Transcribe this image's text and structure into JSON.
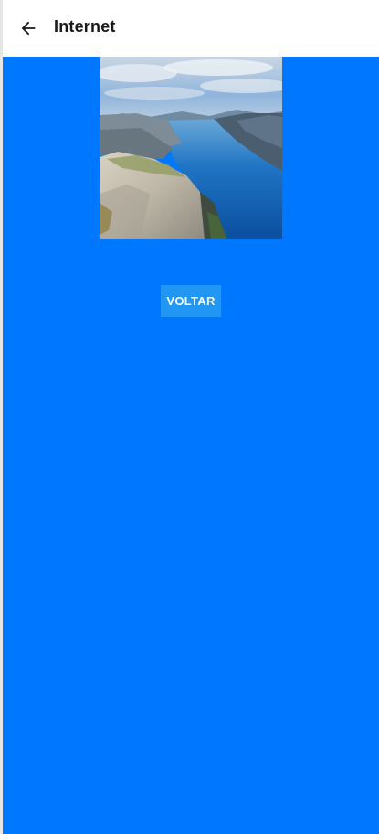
{
  "app_bar": {
    "title": "Internet",
    "back_icon": "arrow-left-icon"
  },
  "main": {
    "image": {
      "subject": "fjord-cliff-landscape"
    },
    "voltar_label": "VOLTAR"
  },
  "colors": {
    "content_background": "#0077ff",
    "button_background": "#2196f3",
    "app_bar_background": "#ffffff",
    "title_color": "#1a1a1a"
  }
}
